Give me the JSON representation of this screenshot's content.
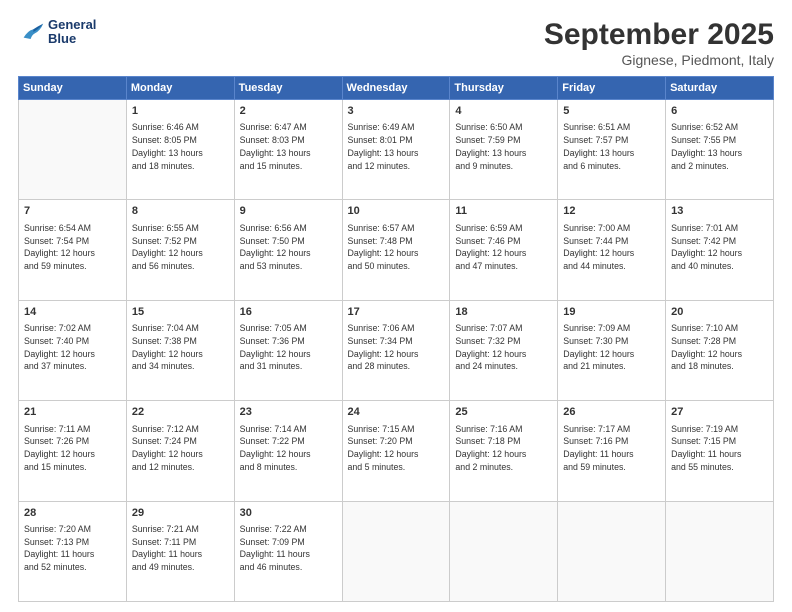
{
  "header": {
    "logo": {
      "line1": "General",
      "line2": "Blue"
    },
    "title": "September 2025",
    "subtitle": "Gignese, Piedmont, Italy"
  },
  "weekdays": [
    "Sunday",
    "Monday",
    "Tuesday",
    "Wednesday",
    "Thursday",
    "Friday",
    "Saturday"
  ],
  "weeks": [
    [
      {
        "day": "",
        "info": ""
      },
      {
        "day": "1",
        "info": "Sunrise: 6:46 AM\nSunset: 8:05 PM\nDaylight: 13 hours\nand 18 minutes."
      },
      {
        "day": "2",
        "info": "Sunrise: 6:47 AM\nSunset: 8:03 PM\nDaylight: 13 hours\nand 15 minutes."
      },
      {
        "day": "3",
        "info": "Sunrise: 6:49 AM\nSunset: 8:01 PM\nDaylight: 13 hours\nand 12 minutes."
      },
      {
        "day": "4",
        "info": "Sunrise: 6:50 AM\nSunset: 7:59 PM\nDaylight: 13 hours\nand 9 minutes."
      },
      {
        "day": "5",
        "info": "Sunrise: 6:51 AM\nSunset: 7:57 PM\nDaylight: 13 hours\nand 6 minutes."
      },
      {
        "day": "6",
        "info": "Sunrise: 6:52 AM\nSunset: 7:55 PM\nDaylight: 13 hours\nand 2 minutes."
      }
    ],
    [
      {
        "day": "7",
        "info": "Sunrise: 6:54 AM\nSunset: 7:54 PM\nDaylight: 12 hours\nand 59 minutes."
      },
      {
        "day": "8",
        "info": "Sunrise: 6:55 AM\nSunset: 7:52 PM\nDaylight: 12 hours\nand 56 minutes."
      },
      {
        "day": "9",
        "info": "Sunrise: 6:56 AM\nSunset: 7:50 PM\nDaylight: 12 hours\nand 53 minutes."
      },
      {
        "day": "10",
        "info": "Sunrise: 6:57 AM\nSunset: 7:48 PM\nDaylight: 12 hours\nand 50 minutes."
      },
      {
        "day": "11",
        "info": "Sunrise: 6:59 AM\nSunset: 7:46 PM\nDaylight: 12 hours\nand 47 minutes."
      },
      {
        "day": "12",
        "info": "Sunrise: 7:00 AM\nSunset: 7:44 PM\nDaylight: 12 hours\nand 44 minutes."
      },
      {
        "day": "13",
        "info": "Sunrise: 7:01 AM\nSunset: 7:42 PM\nDaylight: 12 hours\nand 40 minutes."
      }
    ],
    [
      {
        "day": "14",
        "info": "Sunrise: 7:02 AM\nSunset: 7:40 PM\nDaylight: 12 hours\nand 37 minutes."
      },
      {
        "day": "15",
        "info": "Sunrise: 7:04 AM\nSunset: 7:38 PM\nDaylight: 12 hours\nand 34 minutes."
      },
      {
        "day": "16",
        "info": "Sunrise: 7:05 AM\nSunset: 7:36 PM\nDaylight: 12 hours\nand 31 minutes."
      },
      {
        "day": "17",
        "info": "Sunrise: 7:06 AM\nSunset: 7:34 PM\nDaylight: 12 hours\nand 28 minutes."
      },
      {
        "day": "18",
        "info": "Sunrise: 7:07 AM\nSunset: 7:32 PM\nDaylight: 12 hours\nand 24 minutes."
      },
      {
        "day": "19",
        "info": "Sunrise: 7:09 AM\nSunset: 7:30 PM\nDaylight: 12 hours\nand 21 minutes."
      },
      {
        "day": "20",
        "info": "Sunrise: 7:10 AM\nSunset: 7:28 PM\nDaylight: 12 hours\nand 18 minutes."
      }
    ],
    [
      {
        "day": "21",
        "info": "Sunrise: 7:11 AM\nSunset: 7:26 PM\nDaylight: 12 hours\nand 15 minutes."
      },
      {
        "day": "22",
        "info": "Sunrise: 7:12 AM\nSunset: 7:24 PM\nDaylight: 12 hours\nand 12 minutes."
      },
      {
        "day": "23",
        "info": "Sunrise: 7:14 AM\nSunset: 7:22 PM\nDaylight: 12 hours\nand 8 minutes."
      },
      {
        "day": "24",
        "info": "Sunrise: 7:15 AM\nSunset: 7:20 PM\nDaylight: 12 hours\nand 5 minutes."
      },
      {
        "day": "25",
        "info": "Sunrise: 7:16 AM\nSunset: 7:18 PM\nDaylight: 12 hours\nand 2 minutes."
      },
      {
        "day": "26",
        "info": "Sunrise: 7:17 AM\nSunset: 7:16 PM\nDaylight: 11 hours\nand 59 minutes."
      },
      {
        "day": "27",
        "info": "Sunrise: 7:19 AM\nSunset: 7:15 PM\nDaylight: 11 hours\nand 55 minutes."
      }
    ],
    [
      {
        "day": "28",
        "info": "Sunrise: 7:20 AM\nSunset: 7:13 PM\nDaylight: 11 hours\nand 52 minutes."
      },
      {
        "day": "29",
        "info": "Sunrise: 7:21 AM\nSunset: 7:11 PM\nDaylight: 11 hours\nand 49 minutes."
      },
      {
        "day": "30",
        "info": "Sunrise: 7:22 AM\nSunset: 7:09 PM\nDaylight: 11 hours\nand 46 minutes."
      },
      {
        "day": "",
        "info": ""
      },
      {
        "day": "",
        "info": ""
      },
      {
        "day": "",
        "info": ""
      },
      {
        "day": "",
        "info": ""
      }
    ]
  ]
}
